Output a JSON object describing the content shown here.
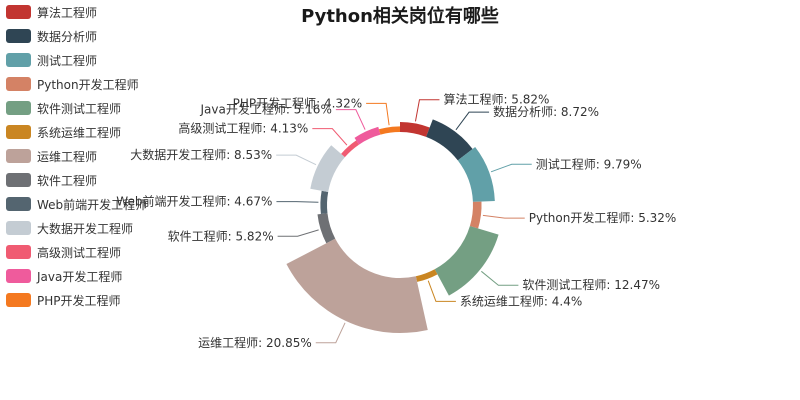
{
  "chart_data": {
    "type": "pie",
    "title": "Python相关岗位有哪些",
    "legend_position": "left",
    "series": [
      {
        "name": "算法工程师",
        "label": "算法工程师: 5.82%",
        "value": 5.82,
        "color": "#c23531"
      },
      {
        "name": "数据分析师",
        "label": "数据分析师: 8.72%",
        "value": 8.72,
        "color": "#2f4554"
      },
      {
        "name": "测试工程师",
        "label": "测试工程师: 9.79%",
        "value": 9.79,
        "color": "#61a0a8"
      },
      {
        "name": "Python开发工程师",
        "label": "Python开发工程师: 5.32%",
        "value": 5.32,
        "color": "#d48265"
      },
      {
        "name": "软件测试工程师",
        "label": "软件测试工程师: 12.47%",
        "value": 12.47,
        "color": "#749f83"
      },
      {
        "name": "系统运维工程师",
        "label": "系统运维工程师: 4.4%",
        "value": 4.4,
        "color": "#ca8622"
      },
      {
        "name": "运维工程师",
        "label": "运维工程师: 20.85%",
        "value": 20.85,
        "color": "#bda29a"
      },
      {
        "name": "软件工程师",
        "label": "软件工程师: 5.82%",
        "value": 5.82,
        "color": "#6e7074"
      },
      {
        "name": "Web前端开发工程师",
        "label": "Web前端开发工程师: 4.67%",
        "value": 4.67,
        "color": "#546570"
      },
      {
        "name": "大数据开发工程师",
        "label": "大数据开发工程师: 8.53%",
        "value": 8.53,
        "color": "#c4ccd3"
      },
      {
        "name": "高级测试工程师",
        "label": "高级测试工程师: 4.13%",
        "value": 4.13,
        "color": "#f05b72"
      },
      {
        "name": "Java开发工程师",
        "label": "Java开发工程师: 5.16%",
        "value": 5.16,
        "color": "#ef5b9c"
      },
      {
        "name": "PHP开发工程师",
        "label": "PHP开发工程师: 4.32%",
        "value": 4.32,
        "color": "#f47920"
      }
    ]
  }
}
